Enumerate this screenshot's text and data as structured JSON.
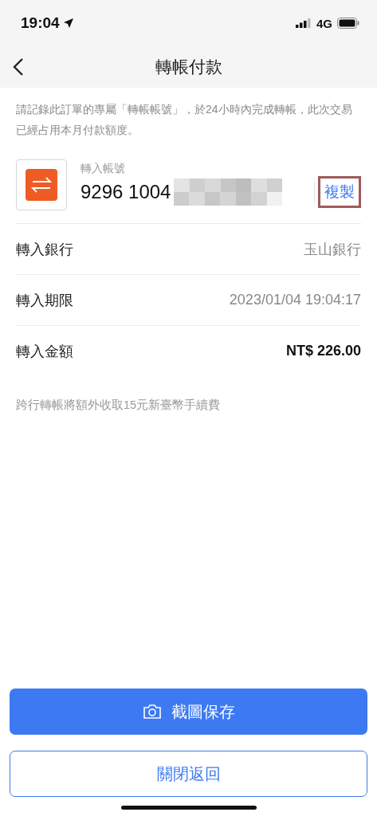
{
  "status_bar": {
    "time": "19:04",
    "network": "4G"
  },
  "nav": {
    "title": "轉帳付款"
  },
  "notice": "請記錄此訂單的專屬「轉帳帳號」，於24小時內完成轉帳，此次交易已經占用本月付款額度。",
  "account": {
    "label": "轉入帳號",
    "number": "9296 1004",
    "redacted": true,
    "copy_label": "複製"
  },
  "rows": [
    {
      "label": "轉入銀行",
      "value": "玉山銀行",
      "emphasis": false
    },
    {
      "label": "轉入期限",
      "value": "2023/01/04 19:04:17",
      "emphasis": false
    },
    {
      "label": "轉入金額",
      "value": "NT$ 226.00",
      "emphasis": true
    }
  ],
  "fee_note": "跨行轉帳將額外收取15元新臺幣手續費",
  "buttons": [
    {
      "label": "截圖保存",
      "kind": "primary"
    },
    {
      "label": "關閉返回",
      "kind": "secondary"
    }
  ]
}
